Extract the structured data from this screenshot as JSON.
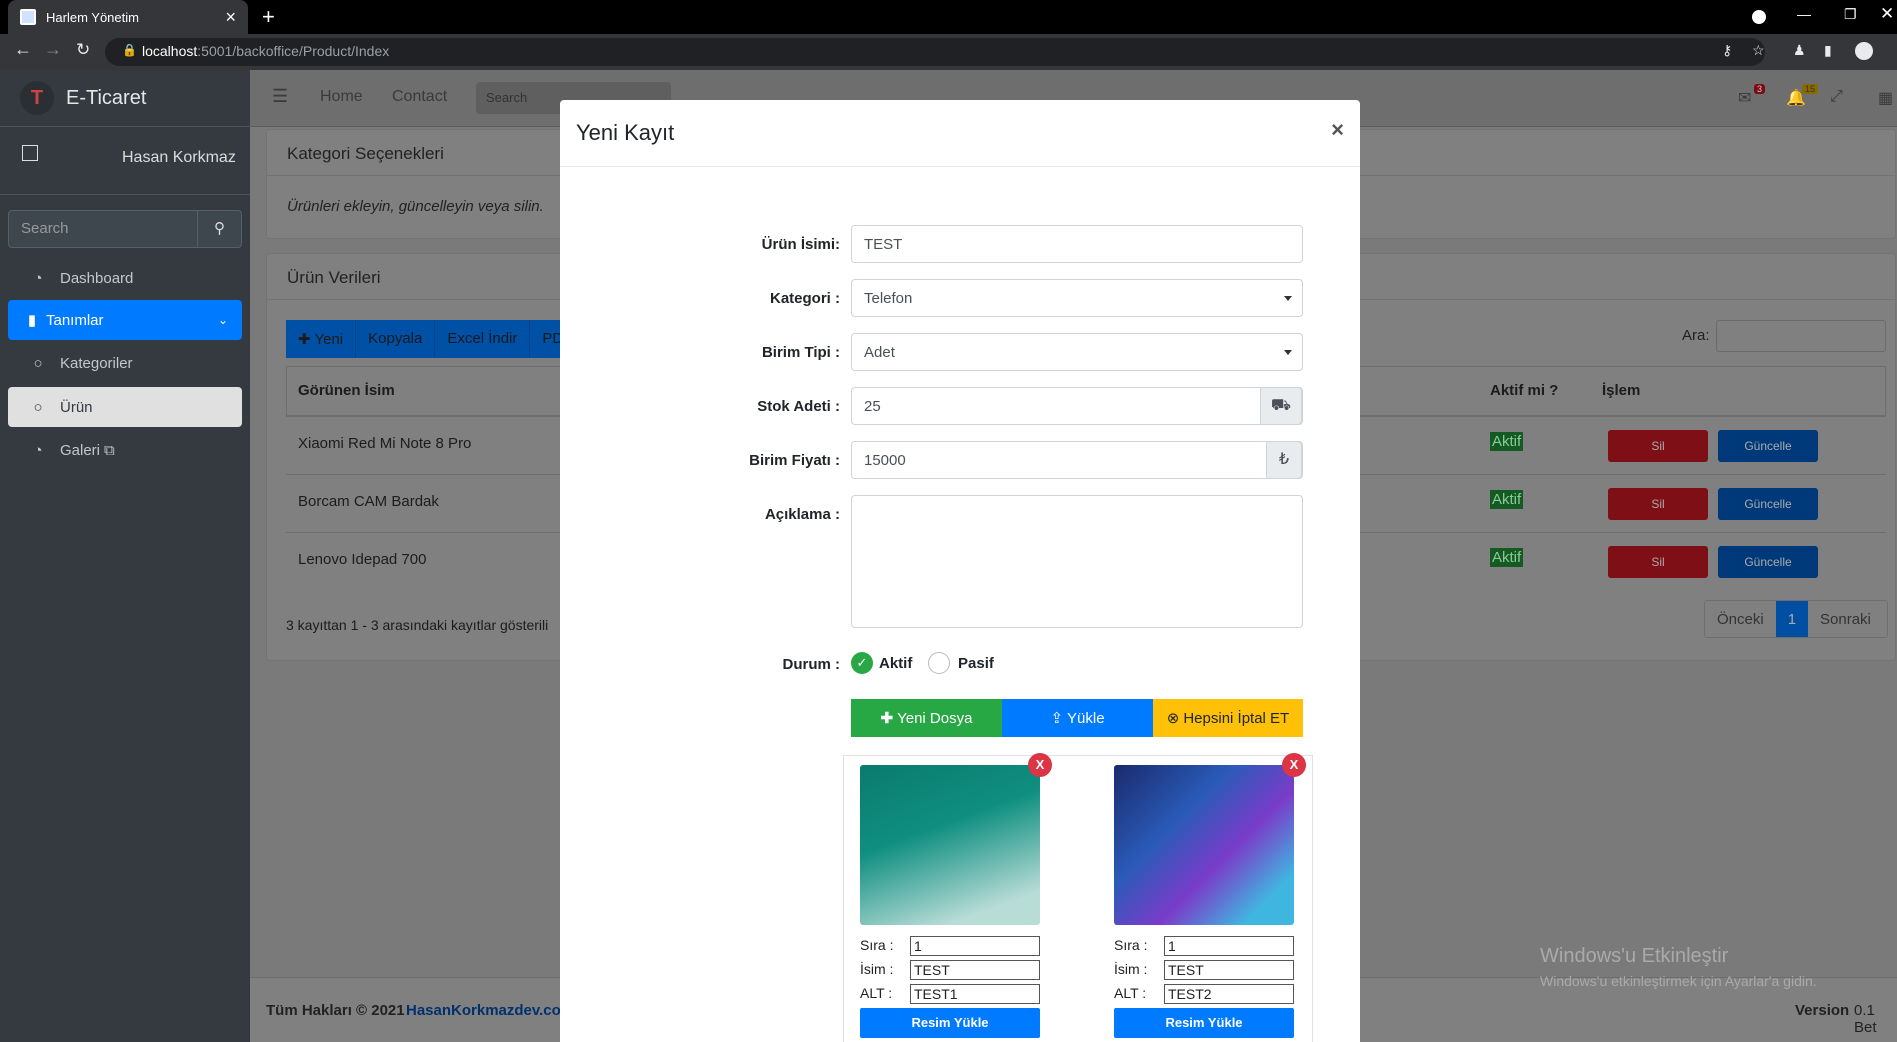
{
  "browser": {
    "tab_title": "Harlem Yönetim",
    "url_host": "localhost",
    "url_path": ":5001/backoffice/Product/Index"
  },
  "sidebar": {
    "brand": "E-Ticaret",
    "brand_logo": "T",
    "user_name": "Hasan Korkmaz",
    "search_placeholder": "Search",
    "items": [
      {
        "label": "Dashboard",
        "icon": "dashboard-icon"
      },
      {
        "label": "Tanımlar",
        "icon": "bookmark-icon"
      },
      {
        "label": "Kategoriler",
        "icon": "circle-icon"
      },
      {
        "label": "Ürün",
        "icon": "circle-icon"
      },
      {
        "label": "Galeri",
        "icon": "gallery-icon"
      }
    ]
  },
  "topnav": {
    "home": "Home",
    "contact": "Contact",
    "search_placeholder": "Search",
    "messages_count": "3",
    "notifications_count": "15"
  },
  "page": {
    "category_card_title": "Kategori Seçenekleri",
    "category_card_text": "Ürünleri ekleyin, güncelleyin veya silin.",
    "data_card_title": "Ürün Verileri",
    "toolbar": [
      "Yeni",
      "Kopyala",
      "Excel İndir",
      "PD"
    ],
    "search_label": "Ara:",
    "columns": [
      "Görünen İsim",
      "Aktif mi ?",
      "İşlem"
    ],
    "rows": [
      {
        "name": "Xiaomi Red Mi Note 8 Pro",
        "status": "Aktif"
      },
      {
        "name": "Borcam CAM Bardak",
        "status": "Aktif"
      },
      {
        "name": "Lenovo Idepad 700",
        "status": "Aktif"
      }
    ],
    "delete_label": "Sil",
    "update_label": "Güncelle",
    "info_text": "3 kayıttan 1 - 3 arasındaki kayıtlar gösterili",
    "pager_prev": "Önceki",
    "pager_current": "1",
    "pager_next": "Sonraki"
  },
  "footer": {
    "copyright": "Tüm Hakları © 2021",
    "site": "HasanKorkmazdev.co",
    "version_label": "Version",
    "version_value": "0.1 Bet"
  },
  "watermark": {
    "title": "Windows'u Etkinleştir",
    "subtitle": "Windows'u etkinleştirmek için Ayarlar'a gidin."
  },
  "modal": {
    "title": "Yeni Kayıt",
    "close": "×",
    "labels": {
      "name": "Ürün İsimi:",
      "category": "Kategori :",
      "unit": "Birim Tipi :",
      "stock": "Stok Adeti :",
      "price": "Birim Fiyatı :",
      "description": "Açıklama :",
      "status": "Durum :"
    },
    "values": {
      "name": "TEST",
      "category": "Telefon",
      "unit": "Adet",
      "stock": "25",
      "price": "15000",
      "currency": "₺"
    },
    "status_options": [
      "Aktif",
      "Pasif"
    ],
    "upload_buttons": {
      "new_file": "Yeni Dosya",
      "upload": "Yükle",
      "cancel_all": "Hepsini İptal ET"
    },
    "images": [
      {
        "order": "1",
        "name": "TEST",
        "alt": "TEST1"
      },
      {
        "order": "1",
        "name": "TEST",
        "alt": "TEST2"
      }
    ],
    "image_labels": {
      "order": "Sıra :",
      "name": "İsim :",
      "alt": "ALT :"
    },
    "image_upload_button": "Resim Yükle",
    "remove_label": "X"
  },
  "colors": {
    "primary": "#007bff",
    "success": "#28a745",
    "warning": "#ffc107",
    "danger": "#dc3545"
  }
}
